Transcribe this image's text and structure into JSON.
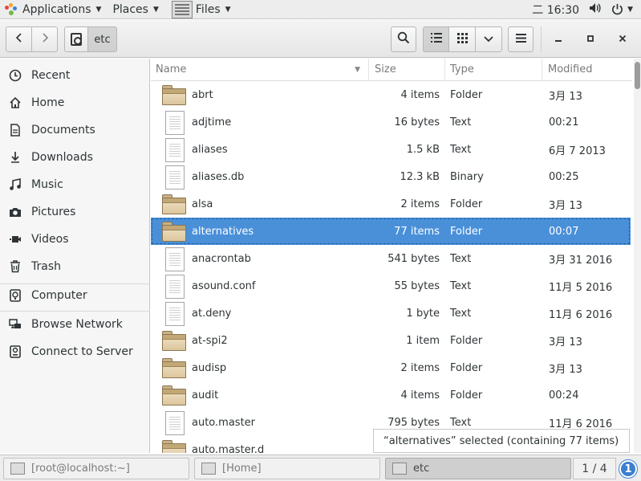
{
  "topbar": {
    "applications": "Applications",
    "places": "Places",
    "files": "Files",
    "clock": "二 16:30"
  },
  "header": {
    "path_label": "etc"
  },
  "sidebar": {
    "items": [
      {
        "label": "Recent",
        "icon": "clock-icon"
      },
      {
        "label": "Home",
        "icon": "home-icon"
      },
      {
        "label": "Documents",
        "icon": "document-icon"
      },
      {
        "label": "Downloads",
        "icon": "download-icon"
      },
      {
        "label": "Music",
        "icon": "music-icon"
      },
      {
        "label": "Pictures",
        "icon": "camera-icon"
      },
      {
        "label": "Videos",
        "icon": "video-icon"
      },
      {
        "label": "Trash",
        "icon": "trash-icon"
      },
      {
        "label": "Computer",
        "icon": "computer-icon"
      },
      {
        "label": "Browse Network",
        "icon": "network-icon"
      },
      {
        "label": "Connect to Server",
        "icon": "server-icon"
      }
    ]
  },
  "columns": {
    "name": "Name",
    "size": "Size",
    "type": "Type",
    "modified": "Modified"
  },
  "files": [
    {
      "name": "abrt",
      "size": "4 items",
      "type": "Folder",
      "modified": "3月 13",
      "kind": "folder"
    },
    {
      "name": "adjtime",
      "size": "16 bytes",
      "type": "Text",
      "modified": "00:21",
      "kind": "doc"
    },
    {
      "name": "aliases",
      "size": "1.5 kB",
      "type": "Text",
      "modified": "6月 7 2013",
      "kind": "doc"
    },
    {
      "name": "aliases.db",
      "size": "12.3 kB",
      "type": "Binary",
      "modified": "00:25",
      "kind": "doc"
    },
    {
      "name": "alsa",
      "size": "2 items",
      "type": "Folder",
      "modified": "3月 13",
      "kind": "folder"
    },
    {
      "name": "alternatives",
      "size": "77 items",
      "type": "Folder",
      "modified": "00:07",
      "kind": "folder",
      "selected": true
    },
    {
      "name": "anacrontab",
      "size": "541 bytes",
      "type": "Text",
      "modified": "3月 31 2016",
      "kind": "doc"
    },
    {
      "name": "asound.conf",
      "size": "55 bytes",
      "type": "Text",
      "modified": "11月 5 2016",
      "kind": "doc"
    },
    {
      "name": "at.deny",
      "size": "1 byte",
      "type": "Text",
      "modified": "11月 6 2016",
      "kind": "doc"
    },
    {
      "name": "at-spi2",
      "size": "1 item",
      "type": "Folder",
      "modified": "3月 13",
      "kind": "folder"
    },
    {
      "name": "audisp",
      "size": "2 items",
      "type": "Folder",
      "modified": "3月 13",
      "kind": "folder"
    },
    {
      "name": "audit",
      "size": "4 items",
      "type": "Folder",
      "modified": "00:24",
      "kind": "folder"
    },
    {
      "name": "auto.master",
      "size": "795 bytes",
      "type": "Text",
      "modified": "11月 6 2016",
      "kind": "doc"
    },
    {
      "name": "auto.master.d",
      "size": "",
      "type": "",
      "modified": "",
      "kind": "folder"
    }
  ],
  "status": "“alternatives” selected  (containing 77 items)",
  "taskbar": {
    "tasks": [
      "[root@localhost:~]",
      "[Home]",
      "etc"
    ],
    "pager": "1 / 4",
    "notifications": "1"
  }
}
